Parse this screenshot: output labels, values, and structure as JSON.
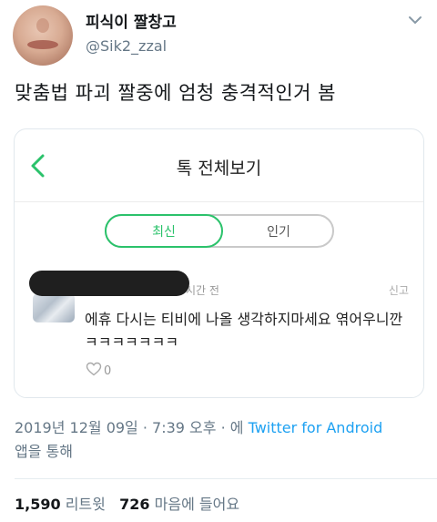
{
  "user": {
    "display_name": "피식이 짤창고",
    "handle": "@Sik2_zzal"
  },
  "tweet": {
    "text": "맞춤법 파괴 짤중에 엄청 충격적인거 봄"
  },
  "media": {
    "screen_title": "톡 전체보기",
    "tabs": {
      "active": "최신",
      "inactive": "인기"
    },
    "comment": {
      "time_suffix": "시간 전",
      "report_label": "신고",
      "text": "에휴 다시는 티비에 나올 생각하지마세요 엮어우니깐 ㅋㅋㅋㅋㅋㅋㅋ",
      "like_count": "0"
    },
    "accent_color": "#2bc26b"
  },
  "meta": {
    "timestamp": "2019년 12월 09일 · 7:39 오후 · 에",
    "source": "Twitter for Android",
    "suffix": "앱을 통해"
  },
  "stats": {
    "retweet_count": "1,590",
    "retweet_label": "리트윗",
    "like_count": "726",
    "like_label": "마음에 들어요"
  }
}
